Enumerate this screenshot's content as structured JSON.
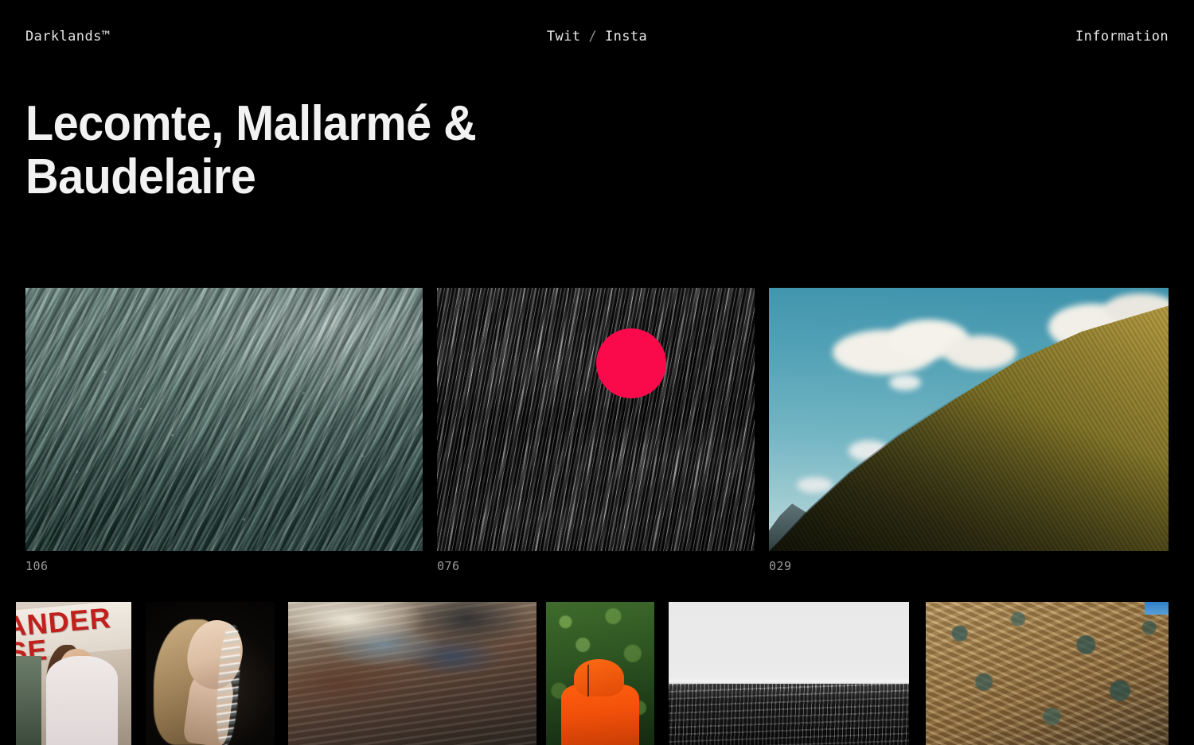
{
  "header": {
    "logo": "Darklands™",
    "nav": [
      {
        "label": "Twit"
      },
      {
        "label": "Insta"
      }
    ],
    "separator": "/",
    "info_link": "Information"
  },
  "hero": {
    "title": "Lecomte, Mallarmé & Baudelaire"
  },
  "colors": {
    "background": "#000000",
    "text": "#f2f2f2",
    "muted_text": "#9a9a9a",
    "accent_dot": "#fa0a4b"
  },
  "gallery": {
    "featured": [
      {
        "caption": "106",
        "alt": "Green teal ocean surface with diagonal ripples",
        "has_dot": false
      },
      {
        "caption": "076",
        "alt": "High contrast black and white stormy sea with red circle overlay",
        "has_dot": true,
        "dot_color": "#fa0a4b"
      },
      {
        "caption": "029",
        "alt": "Blue sky with white clouds over olive green hillside ridge",
        "has_dot": false
      }
    ],
    "thumbnails": [
      {
        "alt": "Woman standing in front of red lettered storefront sign",
        "sign_line_1": "ANDER",
        "sign_line_2": "SE"
      },
      {
        "alt": "Blonde woman with water streaming over face on black background"
      },
      {
        "alt": "Geothermal mineral pool with rust brown cream and blue terraces"
      },
      {
        "alt": "Person in orange hooded jacket facing green foliage"
      },
      {
        "alt": "Black and white seascape with bright horizon"
      },
      {
        "alt": "Rocky arid terrain with ochre rocks and blue green scrub"
      }
    ]
  }
}
